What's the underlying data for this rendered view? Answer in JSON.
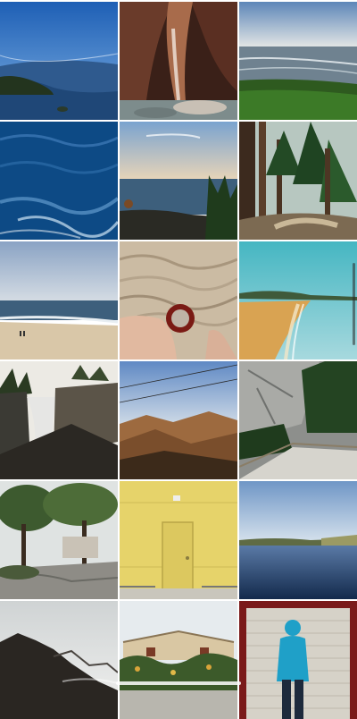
{
  "gallery": {
    "photos": [
      {
        "name": "lake-bay-photo"
      },
      {
        "name": "canyon-slot-photo"
      },
      {
        "name": "ocean-meadow-photo"
      },
      {
        "name": "deep-blue-water-photo"
      },
      {
        "name": "coast-sunset-photo"
      },
      {
        "name": "forest-trail-photo"
      },
      {
        "name": "beach-horizon-photo"
      },
      {
        "name": "sand-ring-photo"
      },
      {
        "name": "aerial-beach-photo"
      },
      {
        "name": "waterfall-cliff-photo"
      },
      {
        "name": "mountain-valley-photo"
      },
      {
        "name": "granite-path-photo"
      },
      {
        "name": "oak-trees-photo"
      },
      {
        "name": "yellow-wall-door-photo"
      },
      {
        "name": "calm-lake-photo"
      },
      {
        "name": "rocky-shore-photo"
      },
      {
        "name": "house-hedge-photo"
      },
      {
        "name": "garage-door-person-photo"
      }
    ]
  },
  "colors": {
    "background": "#ffffff",
    "yellow_wall": "#e6d36a"
  }
}
